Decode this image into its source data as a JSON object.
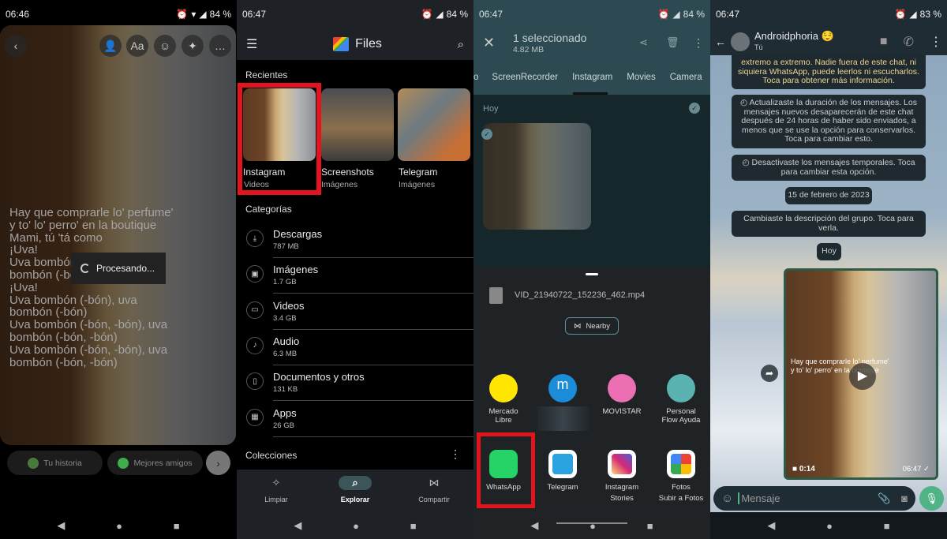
{
  "panel1": {
    "status": {
      "time": "06:46",
      "battery": "84 %"
    },
    "toolbar_icons": [
      "back-icon",
      "tag-person-icon",
      "text-icon",
      "sticker-icon",
      "effects-icon",
      "more-icon"
    ],
    "text_tool": "Aa",
    "lyrics": [
      "Hay que comprarle lo' perfume'",
      "y to' lo' perro' en la boutique",
      "Mami, tú 'tá como",
      "¡Uva!",
      "Uva bombón (-bón), uva",
      "bombón (-bón)",
      "¡Uva!",
      "Uva bombón (-bón), uva",
      "bombón (-bón)",
      "Uva bombón (-bón, -bón), uva",
      "bombón (-bón, -bón)",
      "Uva bombón (-bón, -bón), uva",
      "bombón (-bón, -bón)"
    ],
    "processing": "Procesando...",
    "your_story": "Tu historia",
    "close_friends": "Mejores amigos"
  },
  "panel2": {
    "status": {
      "time": "06:47",
      "battery": "84 %"
    },
    "app_title": "Files",
    "recents_label": "Recientes",
    "recents": [
      {
        "name": "Instagram",
        "type": "Videos"
      },
      {
        "name": "Screenshots",
        "type": "Imágenes"
      },
      {
        "name": "Telegram",
        "type": "Imágenes"
      }
    ],
    "categories_label": "Categorías",
    "categories": [
      {
        "name": "Descargas",
        "size": "787 MB",
        "icon": "download-icon"
      },
      {
        "name": "Imágenes",
        "size": "1.7 GB",
        "icon": "image-icon"
      },
      {
        "name": "Videos",
        "size": "3.4 GB",
        "icon": "video-icon"
      },
      {
        "name": "Audio",
        "size": "6.3 MB",
        "icon": "music-icon"
      },
      {
        "name": "Documentos y otros",
        "size": "131 KB",
        "icon": "document-icon"
      },
      {
        "name": "Apps",
        "size": "26 GB",
        "icon": "apps-icon"
      }
    ],
    "collections_label": "Colecciones",
    "bottom_nav": [
      {
        "label": "Limpiar",
        "icon": "sparkle-icon"
      },
      {
        "label": "Explorar",
        "icon": "browse-icon",
        "active": true
      },
      {
        "label": "Compartir",
        "icon": "nearby-share-icon"
      }
    ],
    "highlight_color": "#e3141c"
  },
  "panel3": {
    "status": {
      "time": "06:47",
      "battery": "84 %"
    },
    "selection_title": "1 seleccionado",
    "selection_size": "4.82 MB",
    "tabs": [
      "o",
      "ScreenRecorder",
      "Instagram",
      "Movies",
      "Camera"
    ],
    "active_tab": "Instagram",
    "date_label": "Hoy",
    "share_file": "VID_21940722_152236_462.mp4",
    "nearby_label": "Nearby",
    "share_targets": [
      {
        "name": "Mercado\nLibre",
        "lines": [
          "Mercado",
          "Libre"
        ],
        "color": "#ffe600"
      },
      {
        "name": "",
        "lines": [
          "",
          ""
        ],
        "color": "#1a8cd8"
      },
      {
        "name": "MOVISTAR",
        "lines": [
          "MOVISTAR",
          ""
        ],
        "color": "#ec6fb4"
      },
      {
        "name": "Personal Flow Ayuda",
        "lines": [
          "Personal",
          "Flow Ayuda"
        ],
        "color": "#5ab3b0"
      },
      {
        "name": "WhatsApp",
        "lines": [
          "WhatsApp",
          ""
        ],
        "color": "#25d366"
      },
      {
        "name": "Telegram",
        "lines": [
          "Telegram",
          ""
        ],
        "color": "#2aa3e0"
      },
      {
        "name": "Instagram Stories",
        "lines": [
          "Instagram",
          "Stories"
        ],
        "color": "#d62976"
      },
      {
        "name": "Fotos Subir a Fotos",
        "lines": [
          "Fotos",
          "Subir a Fotos"
        ],
        "color": "#ffffff"
      }
    ],
    "monogram": "m"
  },
  "panel4": {
    "status": {
      "time": "06:47",
      "battery": "83 %"
    },
    "chat_name": "Androidphoria",
    "chat_subtitle": "Tú",
    "messages": [
      "extremo a extremo. Nadie fuera de este chat, ni siquiera WhatsApp, puede leerlos ni escucharlos. Toca para obtener más información.",
      "Actualizaste la duración de los mensajes. Los mensajes nuevos desaparecerán de este chat después de 24 horas de haber sido enviados, a menos que se use la opción para conservarlos. Toca para cambiar esto.",
      "Desactivaste los mensajes temporales. Toca para cambiar esta opción.",
      "15 de febrero de 2023",
      "Cambiaste la descripción del grupo. Toca para verla.",
      "Hoy"
    ],
    "video_caption": [
      "Hay que comprarle lo' perfume'",
      "y to' lo' perro' en la boutique"
    ],
    "video_duration": "0:14",
    "video_time": "06:47",
    "input_placeholder": "Mensaje"
  }
}
